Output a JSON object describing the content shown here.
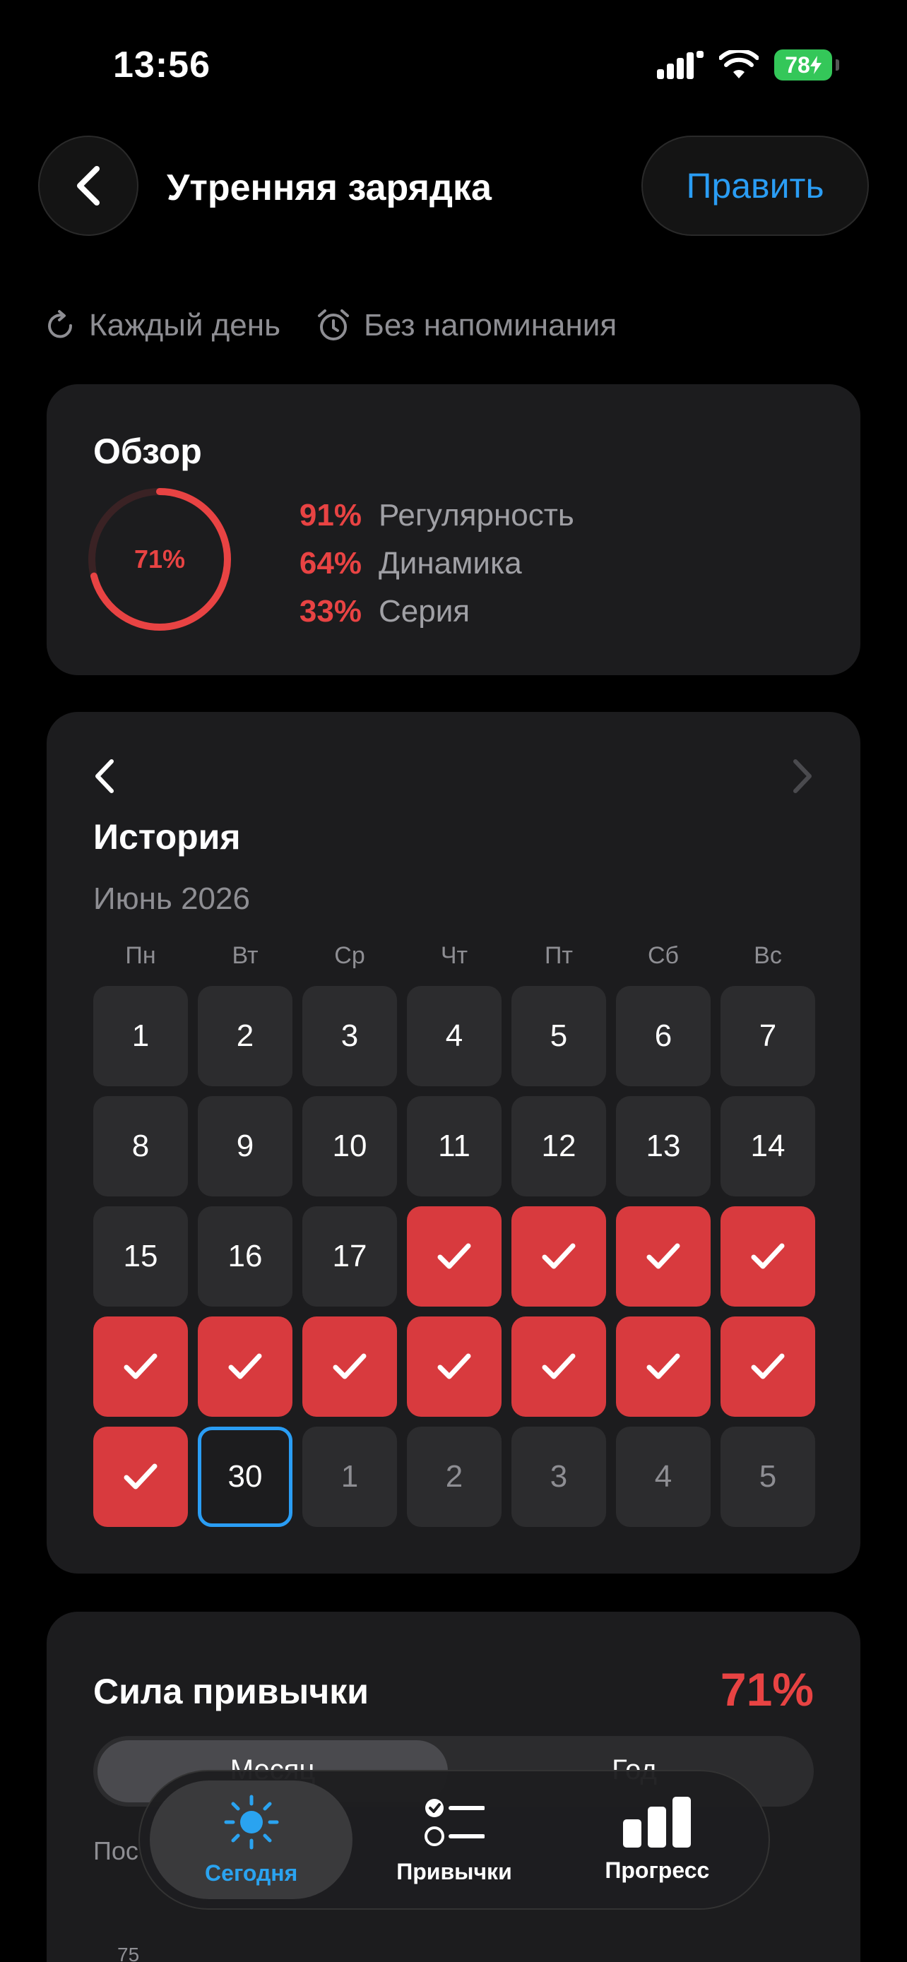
{
  "status": {
    "time": "13:56",
    "battery": "78"
  },
  "header": {
    "title": "Утренняя зарядка",
    "edit_label": "Править"
  },
  "meta": {
    "repeat": "Каждый день",
    "reminder": "Без напоминания"
  },
  "overview": {
    "title": "Обзор",
    "ring_value": "71%",
    "ring_fraction": 0.71,
    "stats": [
      {
        "pct": "91%",
        "label": "Регулярность"
      },
      {
        "pct": "64%",
        "label": "Динамика"
      },
      {
        "pct": "33%",
        "label": "Серия"
      }
    ]
  },
  "history": {
    "title": "История",
    "month": "Июнь 2026",
    "weekdays": [
      "Пн",
      "Вт",
      "Ср",
      "Чт",
      "Пт",
      "Сб",
      "Вс"
    ],
    "days": [
      {
        "label": "1",
        "state": "normal"
      },
      {
        "label": "2",
        "state": "normal"
      },
      {
        "label": "3",
        "state": "normal"
      },
      {
        "label": "4",
        "state": "normal"
      },
      {
        "label": "5",
        "state": "normal"
      },
      {
        "label": "6",
        "state": "normal"
      },
      {
        "label": "7",
        "state": "normal"
      },
      {
        "label": "8",
        "state": "normal"
      },
      {
        "label": "9",
        "state": "normal"
      },
      {
        "label": "10",
        "state": "normal"
      },
      {
        "label": "11",
        "state": "normal"
      },
      {
        "label": "12",
        "state": "normal"
      },
      {
        "label": "13",
        "state": "normal"
      },
      {
        "label": "14",
        "state": "normal"
      },
      {
        "label": "15",
        "state": "normal"
      },
      {
        "label": "16",
        "state": "normal"
      },
      {
        "label": "17",
        "state": "normal"
      },
      {
        "label": "",
        "state": "done"
      },
      {
        "label": "",
        "state": "done"
      },
      {
        "label": "",
        "state": "done"
      },
      {
        "label": "",
        "state": "done"
      },
      {
        "label": "",
        "state": "done"
      },
      {
        "label": "",
        "state": "done"
      },
      {
        "label": "",
        "state": "done"
      },
      {
        "label": "",
        "state": "done"
      },
      {
        "label": "",
        "state": "done"
      },
      {
        "label": "",
        "state": "done"
      },
      {
        "label": "",
        "state": "done"
      },
      {
        "label": "",
        "state": "done"
      },
      {
        "label": "30",
        "state": "today"
      },
      {
        "label": "1",
        "state": "other"
      },
      {
        "label": "2",
        "state": "other"
      },
      {
        "label": "3",
        "state": "other"
      },
      {
        "label": "4",
        "state": "other"
      },
      {
        "label": "5",
        "state": "other"
      }
    ]
  },
  "strength": {
    "title": "Сила привычки",
    "value": "71%",
    "segments": [
      "Месяц",
      "Год"
    ],
    "subtitle": "Пос",
    "tick": "75"
  },
  "tabbar": {
    "tabs": [
      {
        "label": "Сегодня",
        "icon": "sun-icon"
      },
      {
        "label": "Привычки",
        "icon": "checklist-icon"
      },
      {
        "label": "Прогресс",
        "icon": "bar-chart-icon"
      }
    ]
  },
  "colors": {
    "accent_red": "#e84343",
    "done_red": "#d83a3e",
    "accent_blue": "#2a9df4"
  }
}
